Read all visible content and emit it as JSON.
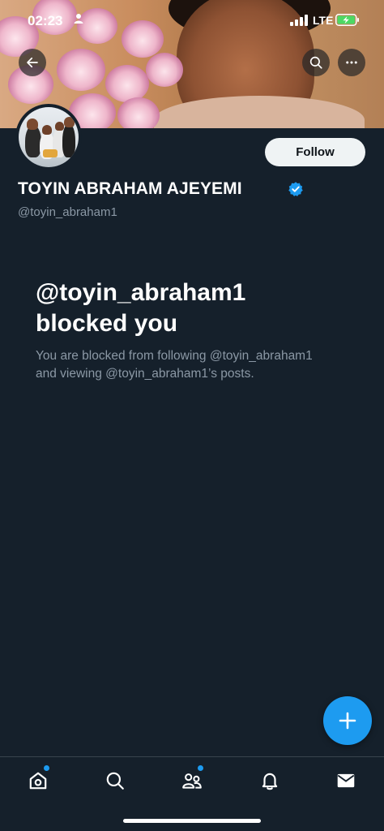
{
  "status_bar": {
    "time": "02:23",
    "network": "LTE"
  },
  "profile": {
    "display_name": "TOYIN ABRAHAM AJEYEMI",
    "handle": "@toyin_abraham1",
    "follow_label": "Follow",
    "verified": true
  },
  "blocked": {
    "title_line1": "@toyin_abraham1",
    "title_line2": "blocked you",
    "description_line1": "You are blocked from following @toyin_abraham1",
    "description_line2": "and viewing @toyin_abraham1’s posts."
  },
  "icons": {
    "back": "arrow-left-icon",
    "search": "search-icon",
    "more": "more-horizontal-icon",
    "verified": "verified-badge-icon",
    "compose": "plus-icon",
    "nav": [
      "home-icon",
      "search-icon",
      "communities-icon",
      "bell-icon",
      "mail-icon"
    ]
  },
  "colors": {
    "background": "#15202b",
    "accent": "#1d9bf0",
    "secondary_text": "#8b98a5",
    "follow_button_bg": "#eff3f4",
    "battery": "#4cd964"
  }
}
